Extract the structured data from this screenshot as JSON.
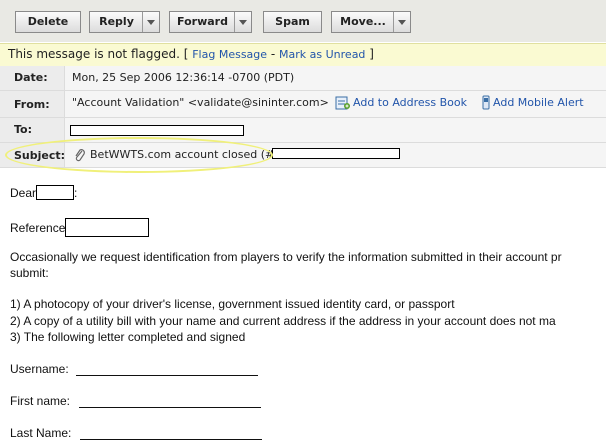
{
  "toolbar": {
    "delete": "Delete",
    "reply": "Reply",
    "forward": "Forward",
    "spam": "Spam",
    "move": "Move..."
  },
  "flag": {
    "status_prefix": "This message is not flagged. [",
    "flag_link": "Flag Message",
    "sep": " - ",
    "unread_link": "Mark as Unread",
    "status_suffix": " ]"
  },
  "headers": {
    "date_label": "Date:",
    "date_value": "Mon, 25 Sep 2006 12:36:14 -0700 (PDT)",
    "from_label": "From:",
    "from_value": "\"Account Validation\" <validate@sininter.com>",
    "add_address": "Add to Address Book",
    "add_mobile": "Add Mobile Alert",
    "to_label": "To:",
    "subject_label": "Subject:",
    "subject_value": "BetWWTS.com account closed (#"
  },
  "body": {
    "dear": "Dear",
    "dear_suffix": ":",
    "reference": "Reference",
    "para1_line1": "Occasionally we request identification from players to verify the information submitted in their account pr",
    "para1_line2": "submit:",
    "item1": "1) A photocopy of your driver's license, government issued identity card, or passport",
    "item2": "2) A copy of a utility bill with your name and current address if the address in your account does not ma",
    "item3": "3) The following letter completed and signed",
    "username_label": "Username:",
    "firstname_label": "First name:",
    "lastname_label": "Last Name:"
  }
}
